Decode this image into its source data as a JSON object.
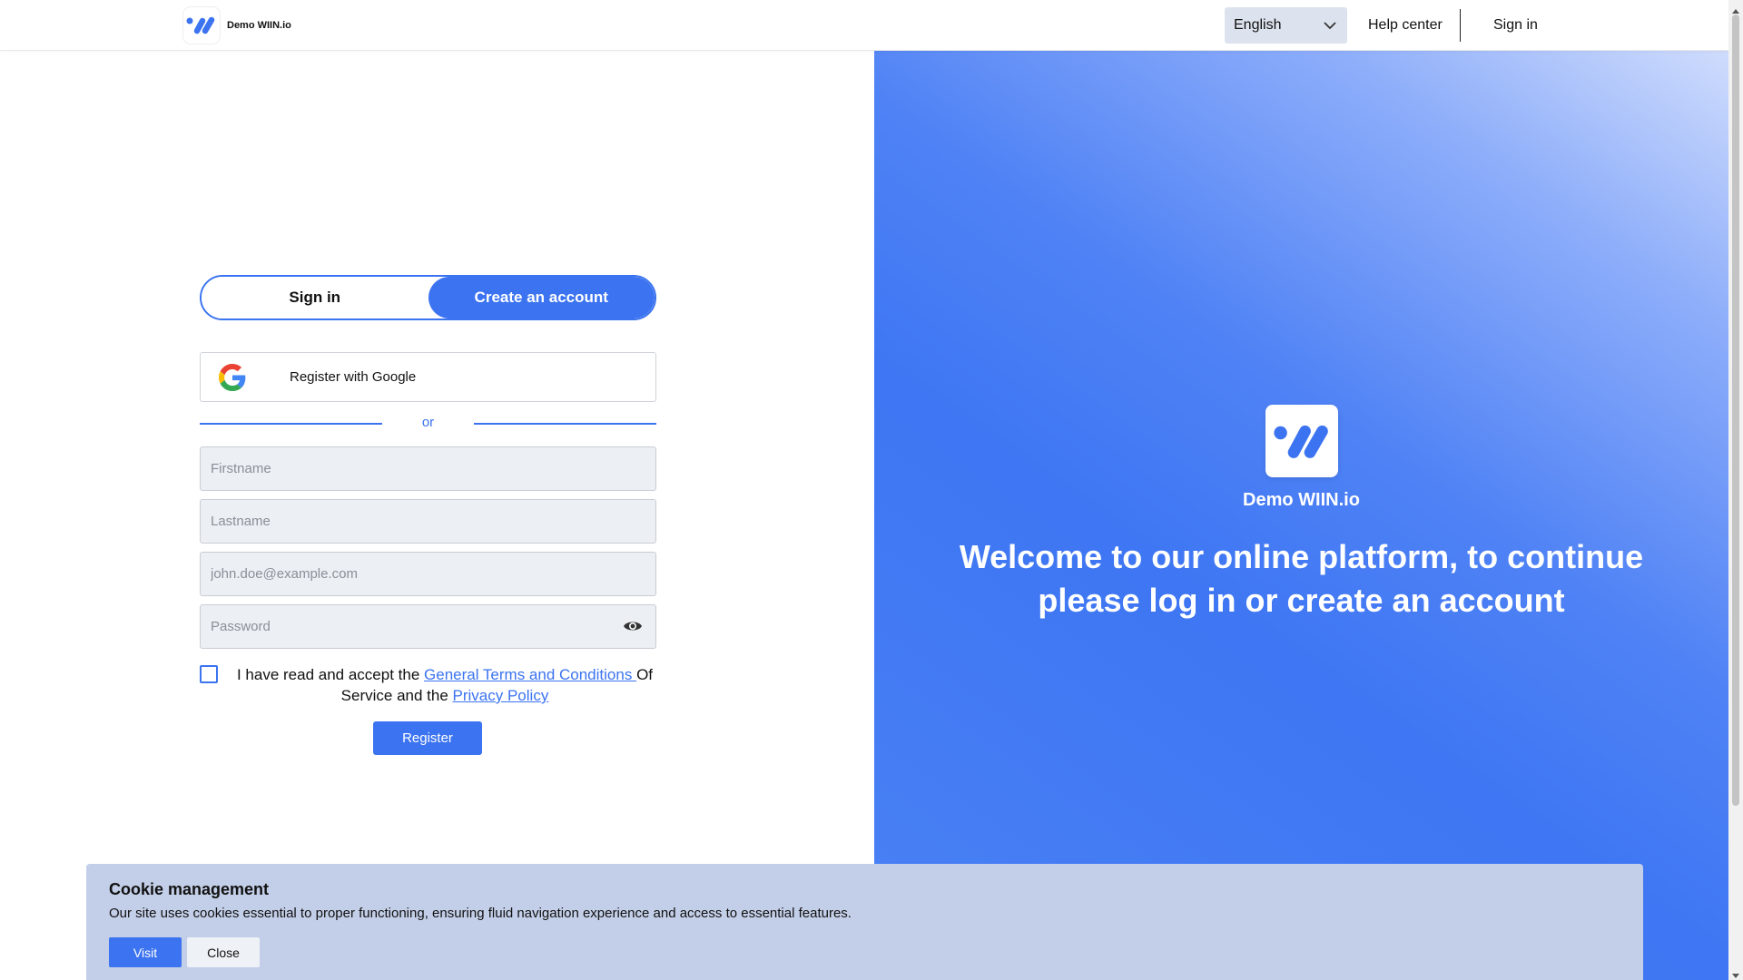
{
  "header": {
    "brand_name": "Demo WIIN.io",
    "language": "English",
    "help_center": "Help center",
    "sign_in": "Sign in"
  },
  "hero": {
    "brand_name": "Demo WIIN.io",
    "welcome": "Welcome to our online platform, to continue please log in or create an account"
  },
  "auth": {
    "tabs": [
      {
        "label": "Sign in",
        "active": false
      },
      {
        "label": "Create an account",
        "active": true
      }
    ],
    "google_label": "Register with Google",
    "or_label": "or",
    "fields": {
      "firstname_placeholder": "Firstname",
      "lastname_placeholder": "Lastname",
      "email_placeholder": "john.doe@example.com",
      "password_placeholder": "Password"
    },
    "terms": {
      "prefix": "I have read and accept the ",
      "terms_link": "General Terms and Conditions ",
      "middle": "Of Service and the ",
      "privacy_link": "Privacy Policy"
    },
    "register_label": "Register"
  },
  "cookie": {
    "title": "Cookie management",
    "text": "Our site uses cookies essential to proper functioning, ensuring fluid navigation experience and access to essential features.",
    "visit_label": "Visit",
    "close_label": "Close"
  },
  "colors": {
    "accent": "#3b73f0",
    "cookie_bg": "#c3cfe8",
    "input_bg": "#eceff4"
  },
  "icons": {
    "brand": "wiin-logo-icon",
    "google": "google-icon",
    "password_toggle": "eye-icon",
    "language_dropdown": "chevron-down-icon"
  }
}
